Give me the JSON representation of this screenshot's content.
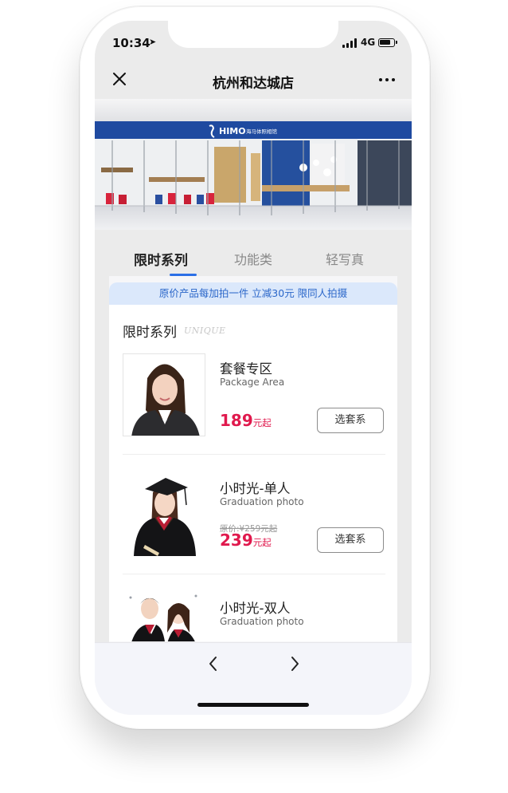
{
  "status_bar": {
    "time": "10:34",
    "location_icon": "location-arrow-icon",
    "network": "4G",
    "signal_icon": "signal-bars-icon",
    "battery_icon": "battery-icon"
  },
  "nav": {
    "title": "杭州和达城店",
    "close_icon": "close-icon",
    "more_icon": "more-icon"
  },
  "banner": {
    "brand": "HIMO",
    "brand_cn": "海马体照相馆"
  },
  "tabs": [
    {
      "label": "限时系列",
      "active": true
    },
    {
      "label": "功能类",
      "active": false
    },
    {
      "label": "轻写真",
      "active": false
    }
  ],
  "promo": "原价产品每加拍一件 立减30元 限同人拍摄",
  "section": {
    "title": "限时系列",
    "subtitle": "UNIQUE"
  },
  "items": [
    {
      "name": "套餐专区",
      "name_en": "Package Area",
      "orig_price": "",
      "price": "189",
      "price_unit": "元起",
      "button": "选套系"
    },
    {
      "name": "小时光-单人",
      "name_en": "Graduation photo",
      "orig_price": "原价:¥259元起",
      "price": "239",
      "price_unit": "元起",
      "button": "选套系"
    },
    {
      "name": "小时光-双人",
      "name_en": "Graduation photo"
    }
  ],
  "toolbar": {
    "back_icon": "chevron-left-icon",
    "forward_icon": "chevron-right-icon"
  },
  "colors": {
    "accent": "#2b6fe6",
    "price": "#e0194d",
    "promo_bg": "#dbe8fb",
    "promo_text": "#2a66c9",
    "banner_blue": "#1f4aa0"
  }
}
